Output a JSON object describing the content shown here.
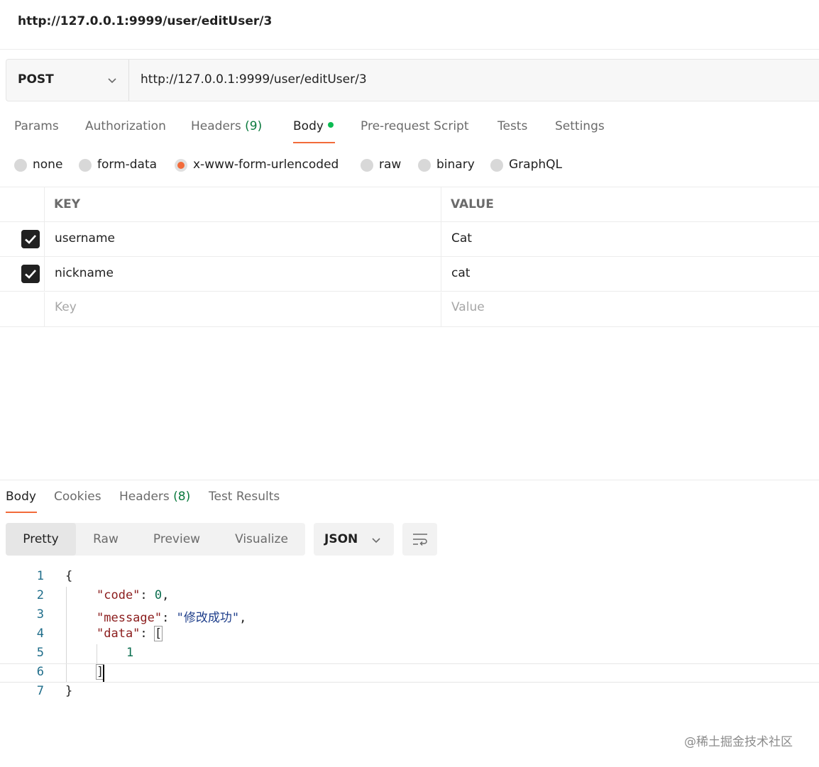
{
  "title": "http://127.0.0.1:9999/user/editUser/3",
  "request": {
    "method": "POST",
    "url": "http://127.0.0.1:9999/user/editUser/3"
  },
  "request_tabs": {
    "params": "Params",
    "authorization": "Authorization",
    "headers": "Headers",
    "headers_count": "(9)",
    "body": "Body",
    "pre_request": "Pre-request Script",
    "tests": "Tests",
    "settings": "Settings"
  },
  "body_types": {
    "none": "none",
    "form_data": "form-data",
    "urlencoded": "x-www-form-urlencoded",
    "raw": "raw",
    "binary": "binary",
    "graphql": "GraphQL",
    "selected": "x-www-form-urlencoded"
  },
  "kv_table": {
    "key_header": "KEY",
    "value_header": "VALUE",
    "rows": [
      {
        "key": "username",
        "value": "Cat",
        "checked": true
      },
      {
        "key": "nickname",
        "value": "cat",
        "checked": true
      }
    ],
    "key_placeholder": "Key",
    "value_placeholder": "Value"
  },
  "response_tabs": {
    "body": "Body",
    "cookies": "Cookies",
    "headers": "Headers",
    "headers_count": "(8)",
    "test_results": "Test Results"
  },
  "view_modes": {
    "pretty": "Pretty",
    "raw": "Raw",
    "preview": "Preview",
    "visualize": "Visualize",
    "format": "JSON"
  },
  "response_code": {
    "line_numbers": [
      "1",
      "2",
      "3",
      "4",
      "5",
      "6",
      "7"
    ],
    "open_brace": "{",
    "close_brace": "}",
    "code_key": "\"code\"",
    "code_value": "0",
    "message_key": "\"message\"",
    "message_value": "\"修改成功\"",
    "data_key": "\"data\"",
    "open_bracket": "[",
    "close_bracket": "]",
    "data_item": "1",
    "colon": ": ",
    "comma": ","
  },
  "watermark": "@稀土掘金技术社区",
  "colors": {
    "accent": "#f26b3a",
    "body_dot": "#0cbb52",
    "count_green": "#0b7a3e"
  }
}
